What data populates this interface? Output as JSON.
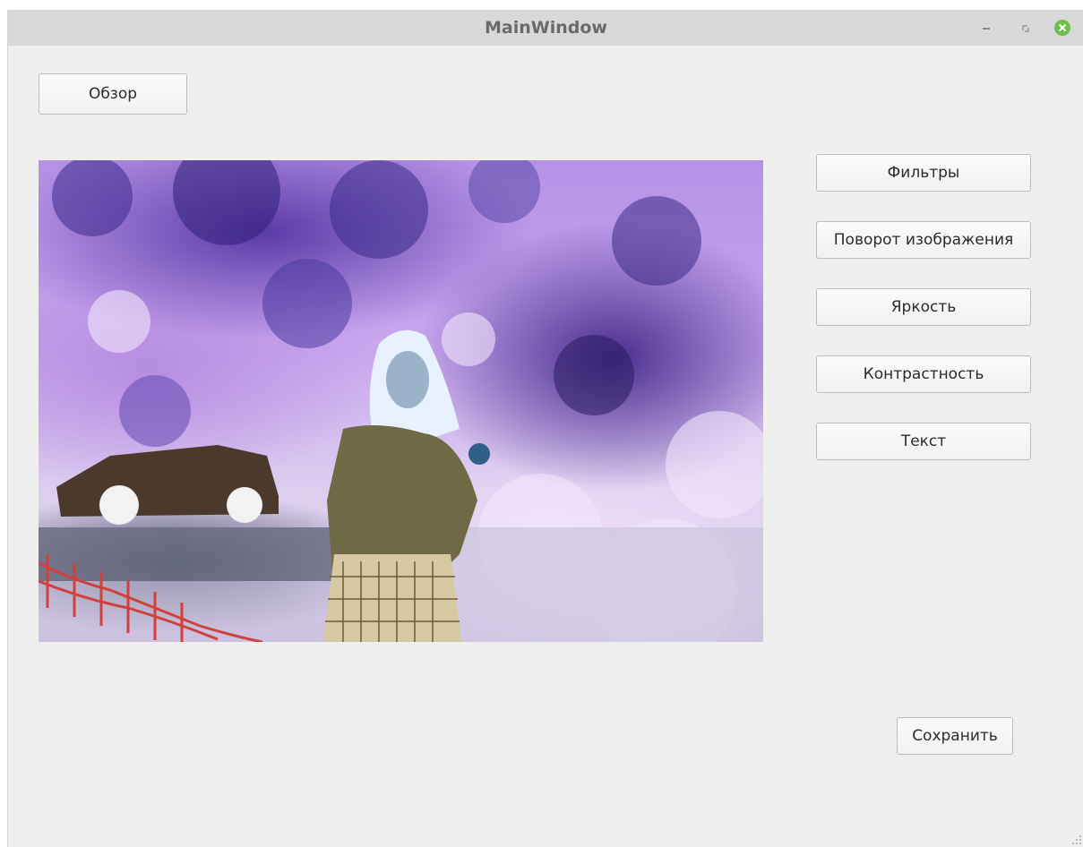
{
  "window": {
    "title": "MainWindow",
    "controls": [
      "minimize-icon",
      "maximize-icon",
      "close-icon"
    ],
    "close_color": "#6fbf4a"
  },
  "buttons": {
    "browse": "Обзор",
    "filters": "Фильтры",
    "rotate": "Поворот изображения",
    "brightness": "Яркость",
    "contrast": "Контрастность",
    "text": "Текст",
    "save": "Сохранить"
  },
  "preview": {
    "content": "loaded-image-inverted-colors"
  }
}
